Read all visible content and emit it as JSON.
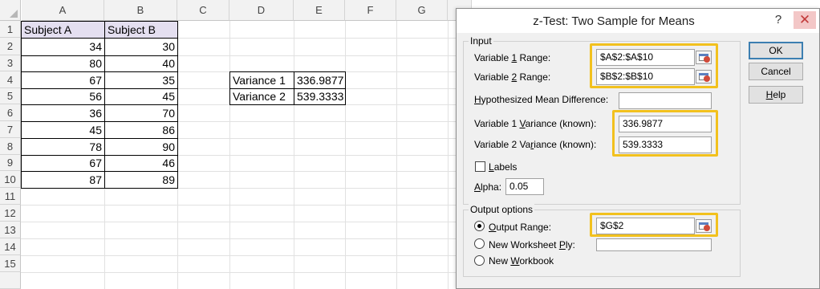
{
  "sheet": {
    "columns": [
      "A",
      "B",
      "C",
      "D",
      "E",
      "F",
      "G"
    ],
    "rows": [
      "1",
      "2",
      "3",
      "4",
      "5",
      "6",
      "7",
      "8",
      "9",
      "10",
      "11",
      "12",
      "13",
      "14",
      "15"
    ],
    "headers": {
      "a1": "Subject A",
      "b1": "Subject B"
    },
    "subject_a": [
      "34",
      "80",
      "67",
      "56",
      "36",
      "45",
      "78",
      "67",
      "87"
    ],
    "subject_b": [
      "30",
      "40",
      "35",
      "45",
      "70",
      "86",
      "90",
      "46",
      "89"
    ],
    "variance": [
      {
        "label": "Variance 1",
        "value": "336.9877"
      },
      {
        "label": "Variance 2",
        "value": "539.3333"
      }
    ],
    "header_fill": "#e4dff0"
  },
  "dialog": {
    "title": "z-Test: Two Sample for Means",
    "help_glyph": "?",
    "close_glyph": "✕",
    "input_group": "Input",
    "var1_label_pre": "Variable ",
    "var1_label_key": "1",
    "var1_label_post": " Range:",
    "var1_value": "$A$2:$A$10",
    "var2_label_pre": "Variable ",
    "var2_label_key": "2",
    "var2_label_post": " Range:",
    "var2_value": "$B$2:$B$10",
    "hyp_label_key": "H",
    "hyp_label_post": "ypothesized Mean Difference:",
    "hyp_value": "",
    "v1var_label_pre": "Variable 1 ",
    "v1var_label_key": "V",
    "v1var_label_post": "ariance (known):",
    "v1var_value": "336.9877",
    "v2var_label_pre": "Variable 2 Va",
    "v2var_label_key": "r",
    "v2var_label_post": "iance (known):",
    "v2var_value": "539.3333",
    "labels_key": "L",
    "labels_post": "abels",
    "labels_checked": false,
    "alpha_key": "A",
    "alpha_post": "lpha:",
    "alpha_value": "0.05",
    "output_group": "Output options",
    "out_range_key": "O",
    "out_range_post": "utput Range:",
    "out_range_value": "$G$2",
    "new_ply_pre": "New Worksheet ",
    "new_ply_key": "P",
    "new_ply_post": "ly:",
    "new_ply_value": "",
    "new_wb_pre": "New ",
    "new_wb_key": "W",
    "new_wb_post": "orkbook",
    "selected_output": "output_range",
    "ok": "OK",
    "cancel": "Cancel",
    "help_pre": "",
    "help_key": "H",
    "help_post": "elp",
    "highlight_color": "#f2c11e",
    "close_color": "#f3c7c7"
  }
}
